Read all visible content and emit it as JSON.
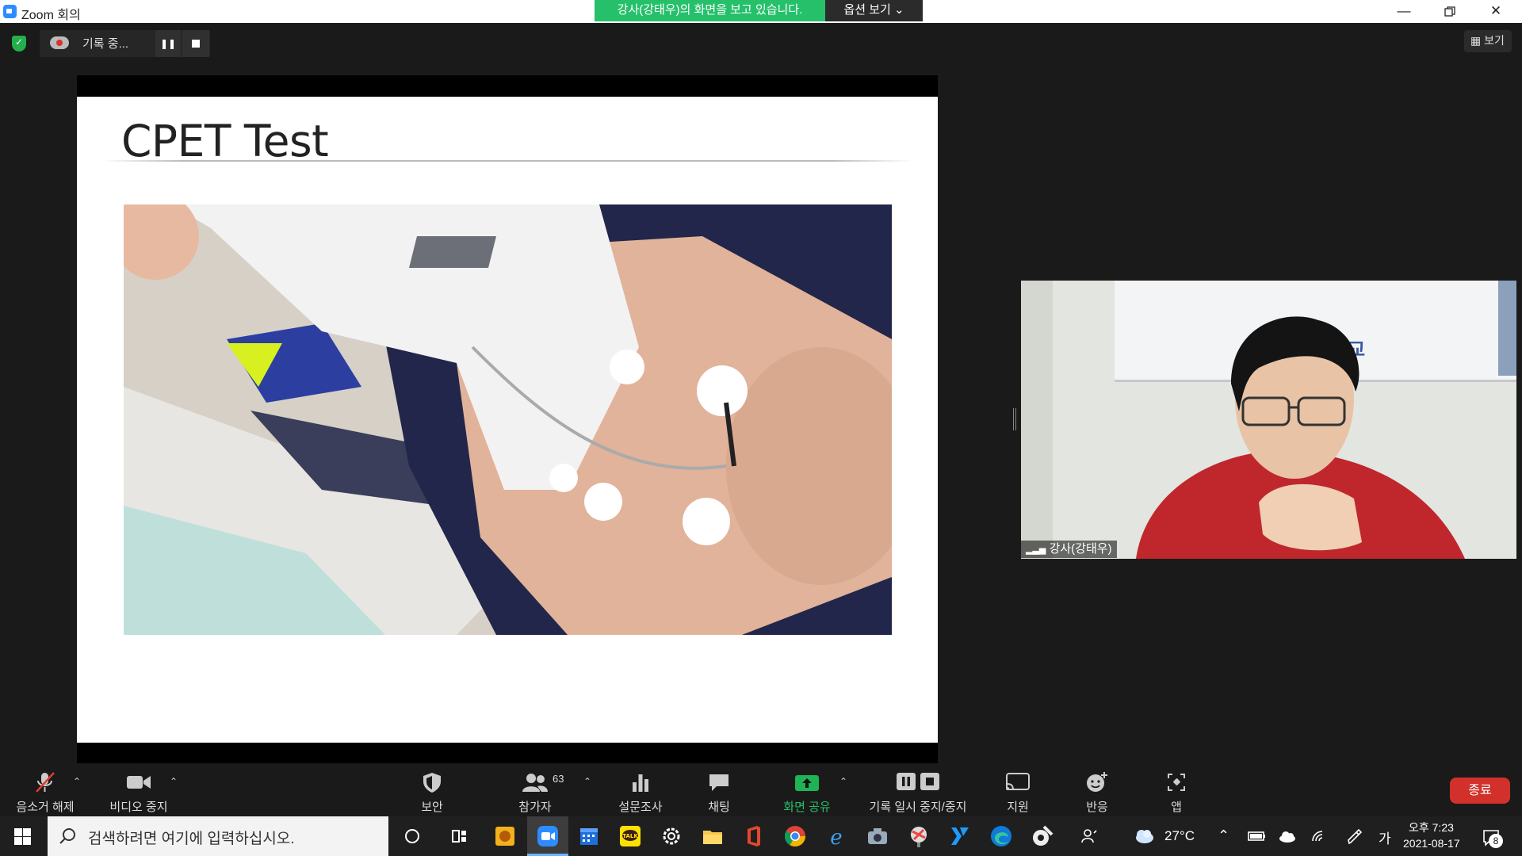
{
  "window": {
    "title": "Zoom 회의",
    "share_banner": "강사(강태우)의 화면을 보고 있습니다.",
    "options_label": "옵션 보기 ⌄"
  },
  "recording": {
    "status_text": "기록 중..."
  },
  "view_label": "보기",
  "slide": {
    "title": "CPET Test"
  },
  "participant": {
    "name": "강사(강태우)"
  },
  "toolbar": {
    "unmute": "음소거 해제",
    "stop_video": "비디오 중지",
    "security": "보안",
    "participants": "참가자",
    "participant_count": "63",
    "polls": "설문조사",
    "chat": "채팅",
    "share_screen": "화면 공유",
    "pause_stop_recording": "기록 일시 중지/중지",
    "support": "지원",
    "reactions": "반응",
    "apps": "앱",
    "end": "종료"
  },
  "taskbar": {
    "search_placeholder": "검색하려면 여기에 입력하십시오.",
    "temperature": "27°C",
    "ime": "가",
    "time": "오후 7:23",
    "date": "2021-08-17",
    "notifications": "8"
  },
  "colors": {
    "accent_green": "#26c06b",
    "share_green": "#1fb355",
    "end_red": "#d1312a",
    "unmute_red": "#e03b2e"
  }
}
